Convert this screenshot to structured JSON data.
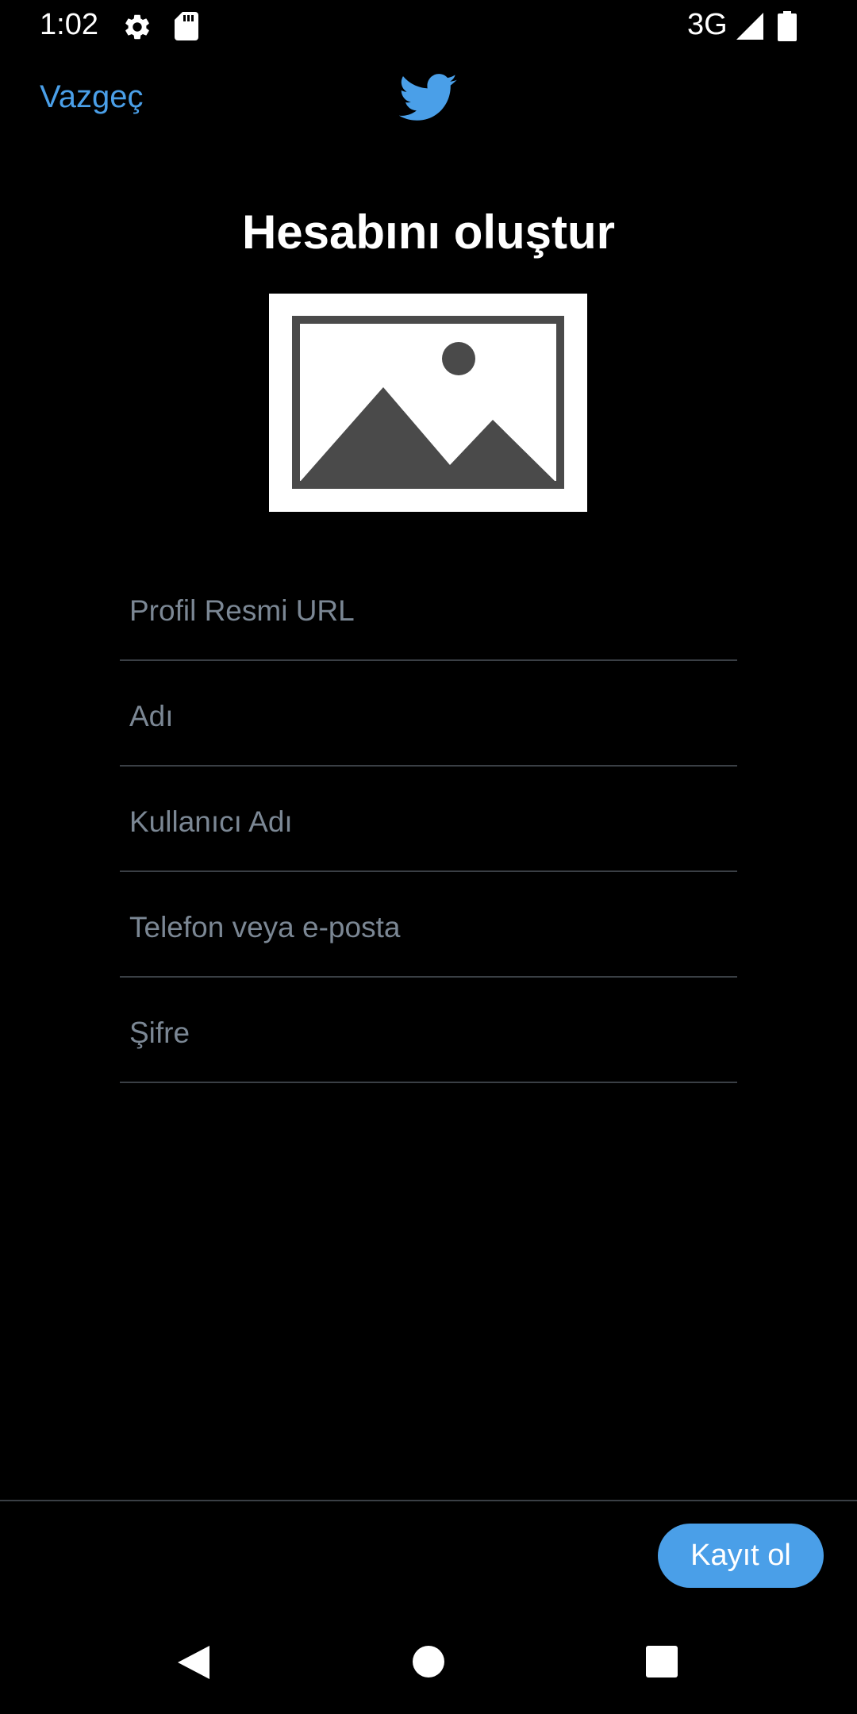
{
  "status_bar": {
    "time": "1:02",
    "network": "3G",
    "icons": [
      "gear-icon",
      "sd-card-icon",
      "signal-icon",
      "battery-icon"
    ]
  },
  "header": {
    "cancel_label": "Vazgeç",
    "logo": "twitter-bird-icon",
    "title": "Hesabını oluştur"
  },
  "form": {
    "fields": [
      {
        "name": "profile-image-url",
        "placeholder": "Profil Resmi URL",
        "value": ""
      },
      {
        "name": "name",
        "placeholder": "Adı",
        "value": ""
      },
      {
        "name": "username",
        "placeholder": "Kullanıcı Adı",
        "value": ""
      },
      {
        "name": "phone-or-email",
        "placeholder": "Telefon veya e-posta",
        "value": ""
      },
      {
        "name": "password",
        "placeholder": "Şifre",
        "value": ""
      }
    ]
  },
  "footer": {
    "signup_label": "Kayıt ol"
  },
  "colors": {
    "accent": "#4a9fe8",
    "background": "#000000",
    "placeholder": "#7b8794",
    "divider": "#3a3f45"
  }
}
